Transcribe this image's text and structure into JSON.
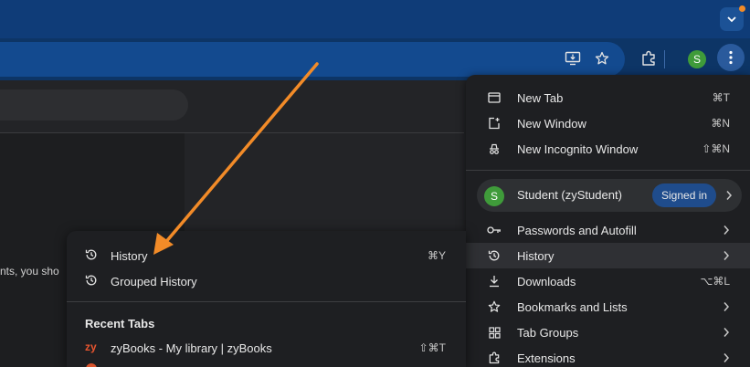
{
  "toolbar": {
    "profile_initial": "S"
  },
  "page": {
    "partial_text": "nts, you sho"
  },
  "main_menu": {
    "items_top": [
      {
        "label": "New Tab",
        "shortcut": "⌘T",
        "icon": "new-tab-icon"
      },
      {
        "label": "New Window",
        "shortcut": "⌘N",
        "icon": "new-window-icon"
      },
      {
        "label": "New Incognito Window",
        "shortcut": "⇧⌘N",
        "icon": "incognito-icon"
      }
    ],
    "profile": {
      "initial": "S",
      "name": "Student (zyStudent)",
      "status": "Signed in"
    },
    "items_bottom": [
      {
        "label": "Passwords and Autofill",
        "shortcut": "",
        "icon": "key-icon",
        "submenu": true
      },
      {
        "label": "History",
        "shortcut": "",
        "icon": "history-icon",
        "submenu": true
      },
      {
        "label": "Downloads",
        "shortcut": "⌥⌘L",
        "icon": "download-icon",
        "submenu": false
      },
      {
        "label": "Bookmarks and Lists",
        "shortcut": "",
        "icon": "star-icon",
        "submenu": true
      },
      {
        "label": "Tab Groups",
        "shortcut": "",
        "icon": "tab-groups-icon",
        "submenu": true
      },
      {
        "label": "Extensions",
        "shortcut": "",
        "icon": "extensions-icon",
        "submenu": true
      }
    ]
  },
  "history_menu": {
    "items": [
      {
        "label": "History",
        "shortcut": "⌘Y"
      },
      {
        "label": "Grouped History",
        "shortcut": ""
      }
    ],
    "recent_heading": "Recent Tabs",
    "recent_tabs": [
      {
        "icon_text": "zy",
        "label": "zyBooks - My library | zyBooks",
        "shortcut": "⇧⌘T"
      }
    ]
  },
  "colors": {
    "accent_arrow": "#f28b28",
    "tabstrip": "#0f3c78",
    "menu_bg": "#1e1f22"
  }
}
